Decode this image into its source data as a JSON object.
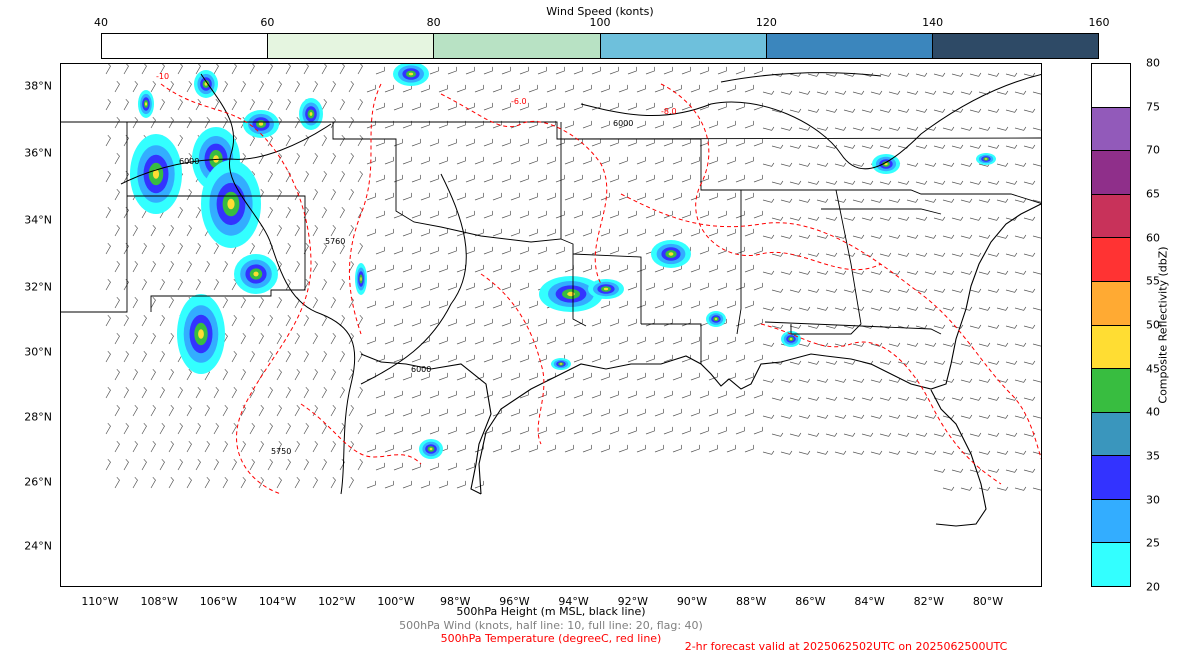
{
  "wind_colorbar": {
    "title": "Wind Speed (konts)",
    "ticks": [
      "40",
      "60",
      "80",
      "100",
      "120",
      "140",
      "160"
    ],
    "colors": [
      "#ffffff",
      "#e5f5e0",
      "#b8e2c4",
      "#6ec0dc",
      "#3b86bd",
      "#2e4a66"
    ]
  },
  "reflectivity_colorbar": {
    "title": "Composite Reflectivity (dbZ)",
    "ticks": [
      "20",
      "25",
      "30",
      "35",
      "40",
      "45",
      "50",
      "55",
      "60",
      "65",
      "70",
      "75",
      "80"
    ],
    "colors": [
      "#33ffff",
      "#33adff",
      "#3333ff",
      "#3a96bd",
      "#38bd40",
      "#ffdd33",
      "#ffaa33",
      "#ff3333",
      "#c8325a",
      "#8f2f8a",
      "#925aba",
      "#ffffff"
    ]
  },
  "map": {
    "lat_labels": [
      "38°N",
      "36°N",
      "34°N",
      "32°N",
      "30°N",
      "28°N",
      "26°N",
      "24°N"
    ],
    "lon_labels": [
      "110°W",
      "108°W",
      "106°W",
      "104°W",
      "102°W",
      "100°W",
      "98°W",
      "96°W",
      "94°W",
      "92°W",
      "90°W",
      "88°W",
      "86°W",
      "84°W",
      "82°W",
      "80°W"
    ],
    "contour_labels": [
      "6000",
      "5760",
      "5750",
      "6000",
      "6000",
      "-8.0",
      "-6.0",
      "-10"
    ]
  },
  "legend": {
    "height_label": "500hPa Height (m MSL, black line)",
    "wind_label": "500hPa Wind (knots, half line: 10, full line: 20, flag: 40)",
    "temp_label": "500hPa Temperature (degreeC, red line)",
    "forecast_label": "2-hr forecast valid at 2025062502UTC on 2025062500UTC"
  },
  "colors": {
    "height_line": "#000000",
    "temp_line": "#ff0000",
    "wind_barb": "#555555",
    "calm_circle": "#555555"
  }
}
